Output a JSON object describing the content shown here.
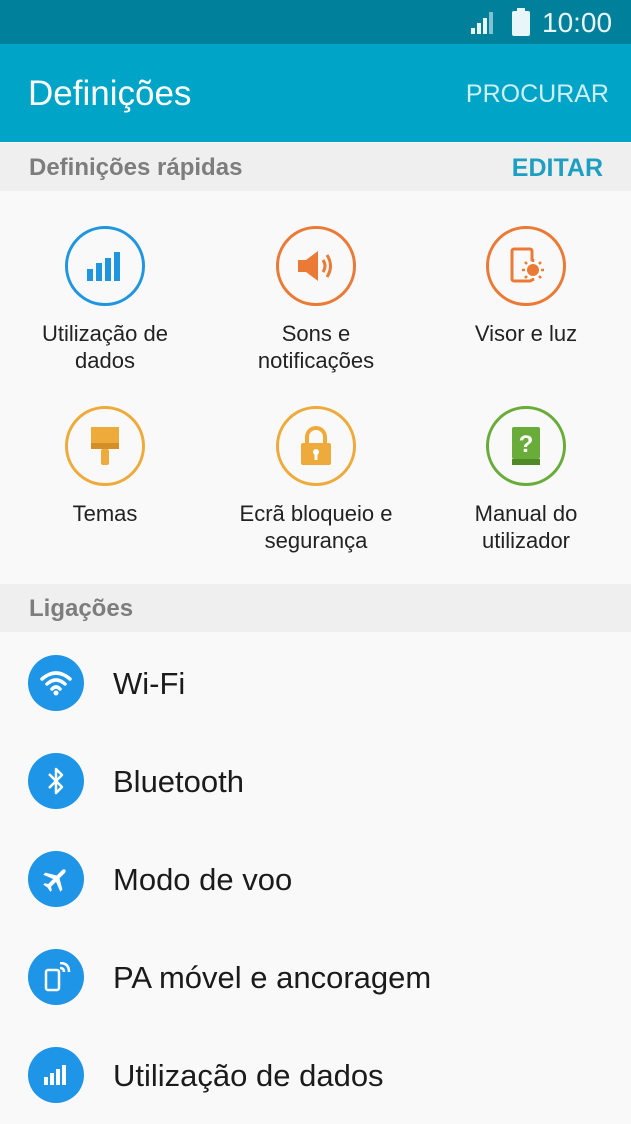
{
  "status": {
    "time": "10:00"
  },
  "appbar": {
    "title": "Definições",
    "action": "PROCURAR"
  },
  "quick": {
    "header": "Definições rápidas",
    "edit": "EDITAR",
    "tiles": [
      {
        "label": "Utilização de\ndados",
        "icon": "data-usage-icon",
        "color": "#2196e0"
      },
      {
        "label": "Sons e\nnotificações",
        "icon": "speaker-icon",
        "color": "#ea7a35"
      },
      {
        "label": "Visor e luz",
        "icon": "display-icon",
        "color": "#ea7a35"
      },
      {
        "label": "Temas",
        "icon": "paintbrush-icon",
        "color": "#eeab3c"
      },
      {
        "label": "Ecrã bloqueio e\nsegurança",
        "icon": "lock-icon",
        "color": "#eeab3c"
      },
      {
        "label": "Manual do\nutilizador",
        "icon": "help-book-icon",
        "color": "#6aac3a"
      }
    ]
  },
  "connections": {
    "header": "Ligações",
    "items": [
      {
        "label": "Wi-Fi",
        "icon": "wifi-icon"
      },
      {
        "label": "Bluetooth",
        "icon": "bluetooth-icon"
      },
      {
        "label": "Modo de voo",
        "icon": "airplane-icon"
      },
      {
        "label": "PA móvel e ancoragem",
        "icon": "hotspot-icon"
      },
      {
        "label": "Utilização de dados",
        "icon": "data-usage-icon"
      }
    ]
  }
}
